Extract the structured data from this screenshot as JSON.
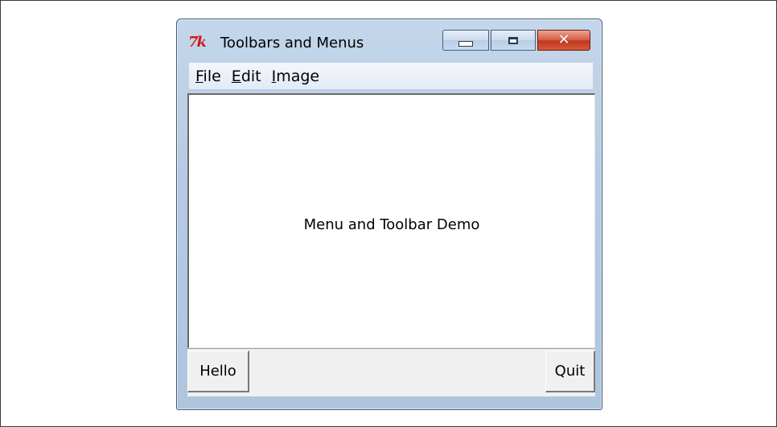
{
  "window": {
    "title": "Toolbars and Menus",
    "app_icon": "tk-feather-icon",
    "controls": [
      "minimize-icon",
      "maximize-icon",
      "close-icon"
    ],
    "close_color": "#c2381d",
    "frame_color": "#b6cbe3"
  },
  "menubar": {
    "items": [
      {
        "mnemonic": "F",
        "rest": "ile"
      },
      {
        "mnemonic": "E",
        "rest": "dit"
      },
      {
        "mnemonic": "I",
        "rest": "mage"
      }
    ]
  },
  "canvas": {
    "text": "Menu and Toolbar Demo"
  },
  "toolbar": {
    "hello_label": "Hello",
    "quit_label": "Quit"
  }
}
